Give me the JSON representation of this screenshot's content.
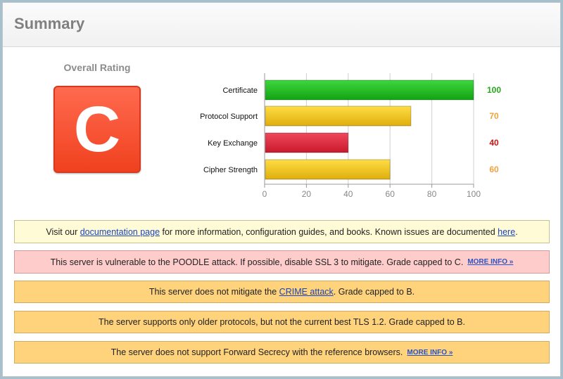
{
  "header": {
    "title": "Summary"
  },
  "rating": {
    "label": "Overall Rating",
    "grade": "C"
  },
  "colors": {
    "green": "#1fb31f",
    "yellow": "#f0c419",
    "red": "#d8243a",
    "value_green": "#27a61c",
    "value_orange": "#f2a23a",
    "value_red": "#c81414"
  },
  "chart_data": {
    "type": "bar",
    "orientation": "horizontal",
    "categories": [
      "Certificate",
      "Protocol Support",
      "Key Exchange",
      "Cipher Strength"
    ],
    "values": [
      100,
      70,
      40,
      60
    ],
    "value_labels": [
      "100",
      "70",
      "40",
      "60"
    ],
    "bar_colors": [
      "green",
      "yellow",
      "red",
      "yellow"
    ],
    "xlim": [
      0,
      100
    ],
    "xticks": [
      "0",
      "20",
      "40",
      "60",
      "80",
      "100"
    ],
    "grid": true
  },
  "notices": {
    "info": {
      "prefix": "Visit our ",
      "link1": "documentation page",
      "middle": " for more information, configuration guides, and books. Known issues are documented ",
      "link2": "here",
      "suffix": "."
    },
    "poodle": {
      "text": "This server is vulnerable to the POODLE attack. If possible, disable SSL 3 to mitigate. Grade capped to C.",
      "more": "MORE INFO »"
    },
    "crime": {
      "prefix": "This server does not mitigate the ",
      "link": "CRIME attack",
      "suffix": ". Grade capped to B."
    },
    "tls": {
      "text": "The server supports only older protocols, but not the current best TLS 1.2. Grade capped to B."
    },
    "fs": {
      "text": "The server does not support Forward Secrecy with the reference browsers.",
      "more": "MORE INFO »"
    }
  }
}
